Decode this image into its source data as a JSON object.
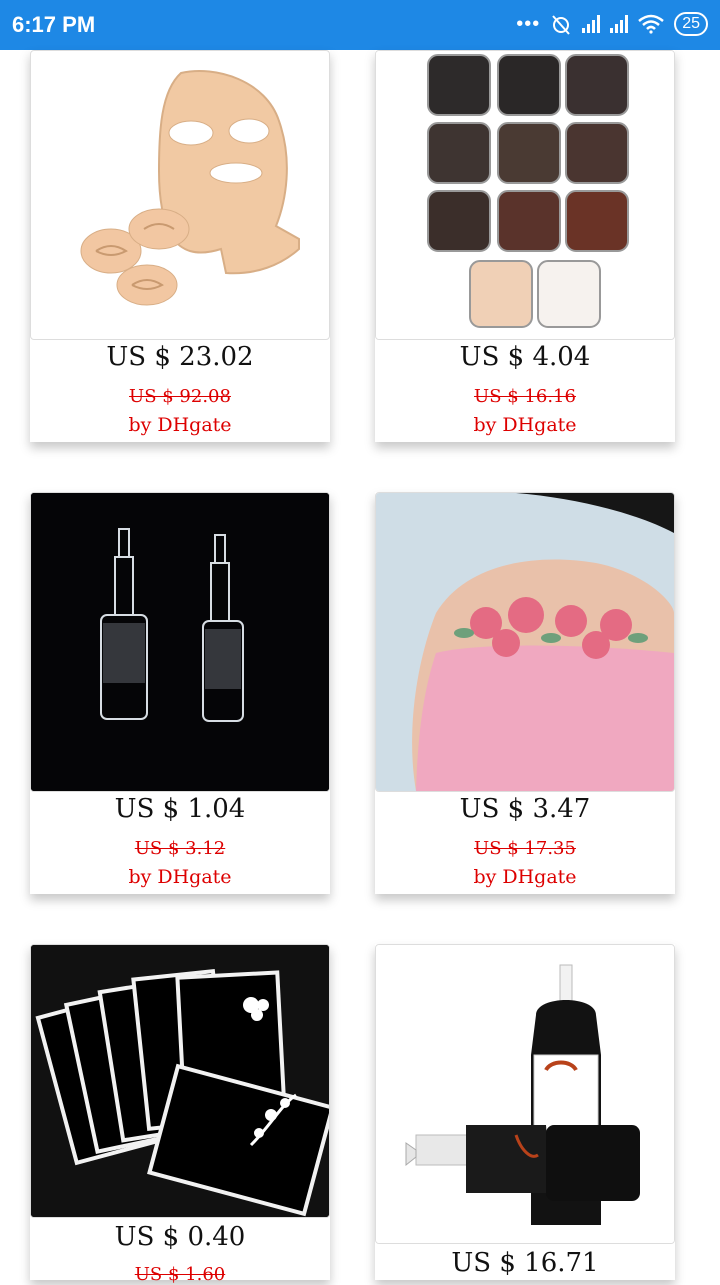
{
  "status_bar": {
    "time": "6:17 PM",
    "battery": "25"
  },
  "products": [
    {
      "price": "US $ 23.02",
      "old_price": "US $ 92.08",
      "seller": "by DHgate",
      "image": "training-face-image"
    },
    {
      "price": "US $ 4.04",
      "old_price": "US $ 16.16",
      "seller": "by DHgate",
      "image": "pigment-jars-image"
    },
    {
      "price": "US $ 1.04",
      "old_price": "US $ 3.12",
      "seller": "by DHgate",
      "image": "needle-cartridges-image"
    },
    {
      "price": "US $ 3.47",
      "old_price": "US $ 17.35",
      "seller": "by DHgate",
      "image": "rose-tattoo-image"
    },
    {
      "price": "US $ 0.40",
      "old_price": "US $ 1.60",
      "image": "stencil-sheets-image"
    },
    {
      "price": "US $ 16.71",
      "image": "ink-bottles-image"
    }
  ]
}
